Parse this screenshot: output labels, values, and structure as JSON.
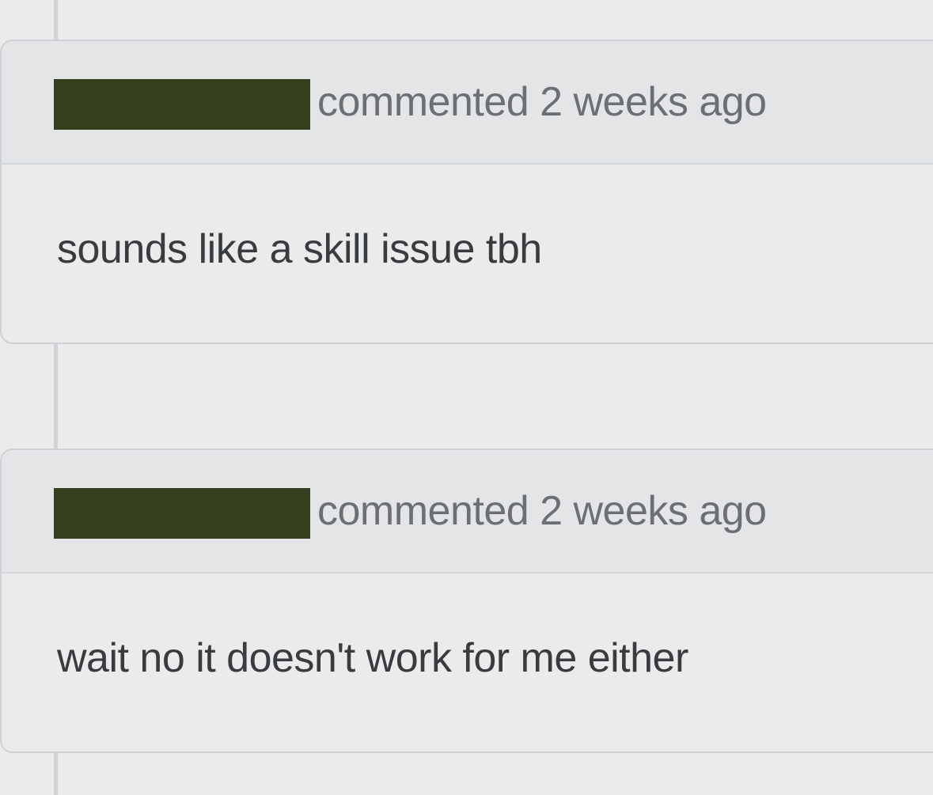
{
  "comments": [
    {
      "author_redacted": true,
      "meta": "commented 2 weeks ago",
      "body": "sounds like a skill issue tbh"
    },
    {
      "author_redacted": true,
      "meta": "commented 2 weeks ago",
      "body": "wait no it doesn't work for me either"
    }
  ],
  "colors": {
    "background": "#ebebeb",
    "header_background": "#e4e5e7",
    "border": "#cdd1d6",
    "redaction": "#353f1f",
    "meta_text": "#6c6f74",
    "body_text": "#383b3f"
  }
}
